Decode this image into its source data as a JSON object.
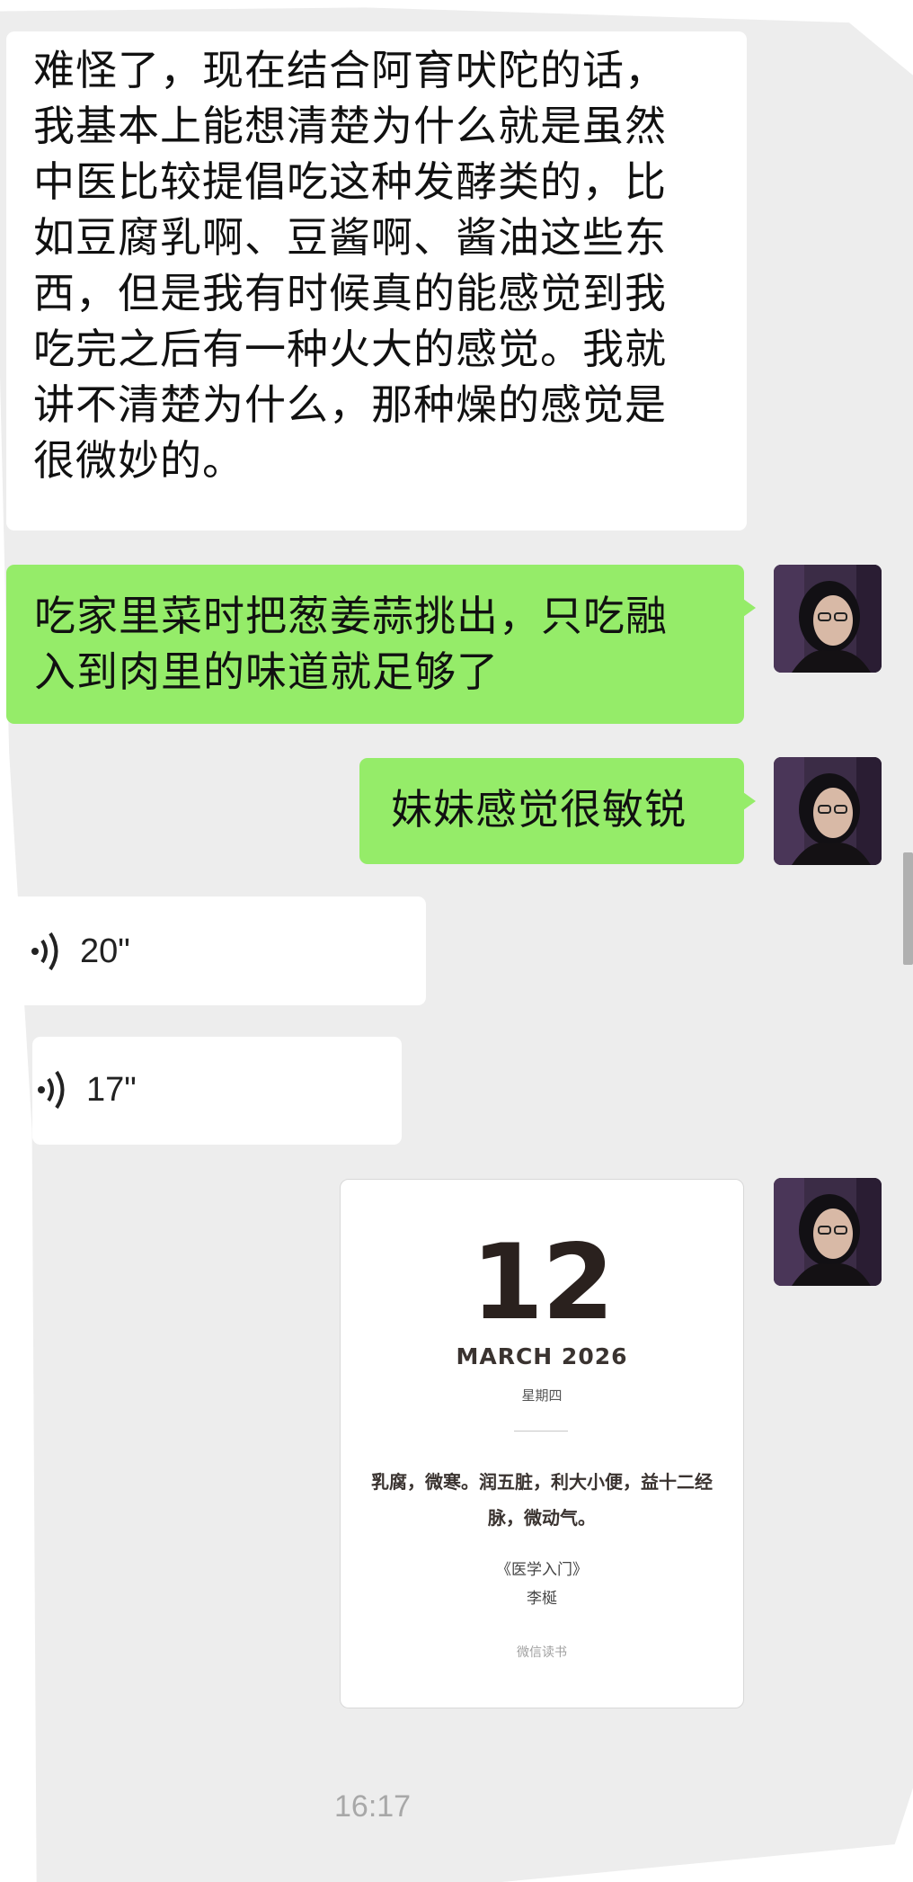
{
  "messages": [
    {
      "type": "text",
      "direction": "incoming",
      "text": "难怪了，现在结合阿育吠陀的话，\n我基本上能想清楚为什么就是虽然\n中医比较提倡吃这种发酵类的，比\n如豆腐乳啊、豆酱啊、酱油这些东\n西，但是我有时候真的能感觉到我\n吃完之后有一种火大的感觉。我就\n讲不清楚为什么，那种燥的感觉是\n很微妙的。"
    },
    {
      "type": "text",
      "direction": "outgoing",
      "text": "吃家里菜时把葱姜蒜挑出，只吃融\n入到肉里的味道就足够了"
    },
    {
      "type": "text",
      "direction": "outgoing",
      "text": "妹妹感觉很敏锐"
    },
    {
      "type": "voice",
      "direction": "incoming",
      "duration": "20\""
    },
    {
      "type": "voice",
      "direction": "incoming",
      "duration": "17\""
    },
    {
      "type": "card",
      "direction": "outgoing",
      "day": "12",
      "month": "MARCH 2026",
      "weekday": "星期四",
      "quote": "乳腐，微寒。润五脏，利大小便，益十二经脉，微动气。",
      "book": "《医学入门》",
      "author": "李梴",
      "source": "微信读书"
    }
  ],
  "timestamp": "16:17",
  "icons": {
    "avatar": "user-avatar",
    "voice": "voice-wave-icon"
  },
  "colors": {
    "background": "#ededed",
    "incoming_bubble": "#ffffff",
    "outgoing_bubble": "#95ec69",
    "timestamp": "#a8a8a8"
  }
}
